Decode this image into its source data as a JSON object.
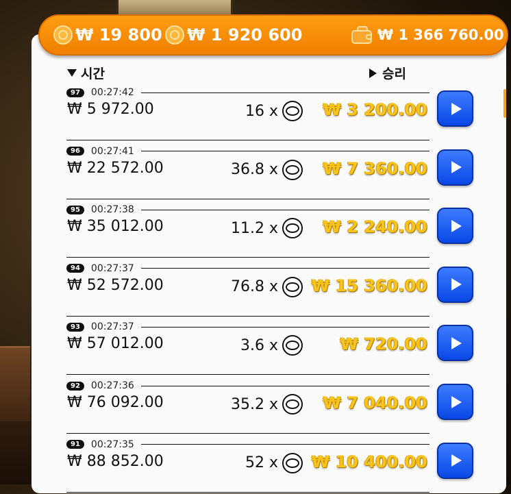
{
  "header": {
    "coin_balance": "₩ 19 800",
    "coin_total": "₩ 1 920 600",
    "wallet_balance": "₩ 1 366 760.00"
  },
  "columns": {
    "time_label": "시간",
    "win_label": "승리"
  },
  "rows": [
    {
      "round": "97",
      "time": "00:27:42",
      "bet": "₩ 5 972.00",
      "multiplier": "16 x",
      "win": "₩ 3 200.00"
    },
    {
      "round": "96",
      "time": "00:27:41",
      "bet": "₩ 22 572.00",
      "multiplier": "36.8 x",
      "win": "₩ 7 360.00"
    },
    {
      "round": "95",
      "time": "00:27:38",
      "bet": "₩ 35 012.00",
      "multiplier": "11.2 x",
      "win": "₩ 2 240.00"
    },
    {
      "round": "94",
      "time": "00:27:37",
      "bet": "₩ 52 572.00",
      "multiplier": "76.8 x",
      "win": "₩ 15 360.00"
    },
    {
      "round": "93",
      "time": "00:27:37",
      "bet": "₩ 57 012.00",
      "multiplier": "3.6 x",
      "win": "₩ 720.00"
    },
    {
      "round": "92",
      "time": "00:27:36",
      "bet": "₩ 76 092.00",
      "multiplier": "35.2 x",
      "win": "₩ 7 040.00"
    },
    {
      "round": "91",
      "time": "00:27:35",
      "bet": "₩ 88 852.00",
      "multiplier": "52 x",
      "win": "₩ 10 400.00"
    }
  ],
  "colors": {
    "header": "#ef7f00",
    "win_text": "#f7c31d",
    "play_button": "#0a48e6"
  }
}
